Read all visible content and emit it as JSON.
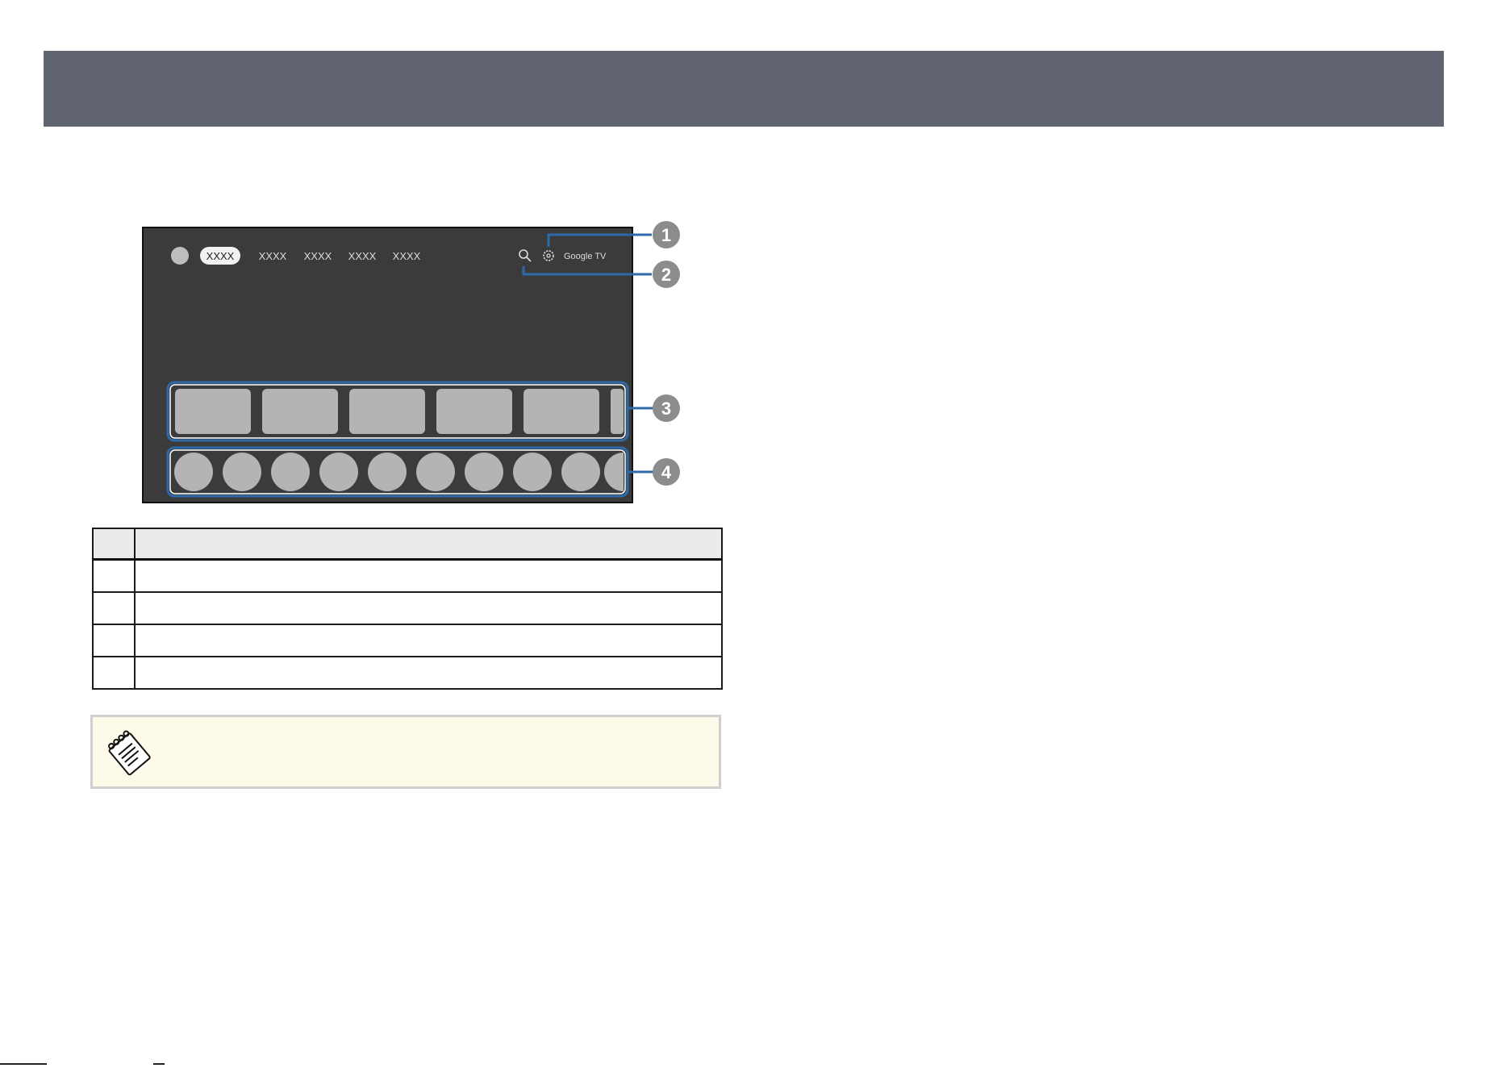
{
  "screen": {
    "nav_tabs": [
      "XXXX",
      "XXXX",
      "XXXX",
      "XXXX",
      "XXXX"
    ],
    "brand_label": "Google TV",
    "app_tile_count": 6,
    "app_icon_count": 10
  },
  "callouts": [
    {
      "number": "1",
      "target": "settings-icon"
    },
    {
      "number": "2",
      "target": "search-icon"
    },
    {
      "number": "3",
      "target": "app-tile-row"
    },
    {
      "number": "4",
      "target": "app-icon-row"
    }
  ],
  "legend_table": {
    "header": [
      "",
      ""
    ],
    "rows": [
      [
        "",
        ""
      ],
      [
        "",
        ""
      ],
      [
        "",
        ""
      ],
      [
        "",
        ""
      ]
    ]
  },
  "note": {
    "icon": "memo-pencil-icon",
    "text": ""
  },
  "colors": {
    "header_band": "#616471",
    "screen_bg": "#3b3b3b",
    "callout_blue": "#2f6aa8",
    "callout_badge": "#8c8c8c",
    "tile": "#b4b4b4",
    "note_bg": "#fdfaea"
  }
}
